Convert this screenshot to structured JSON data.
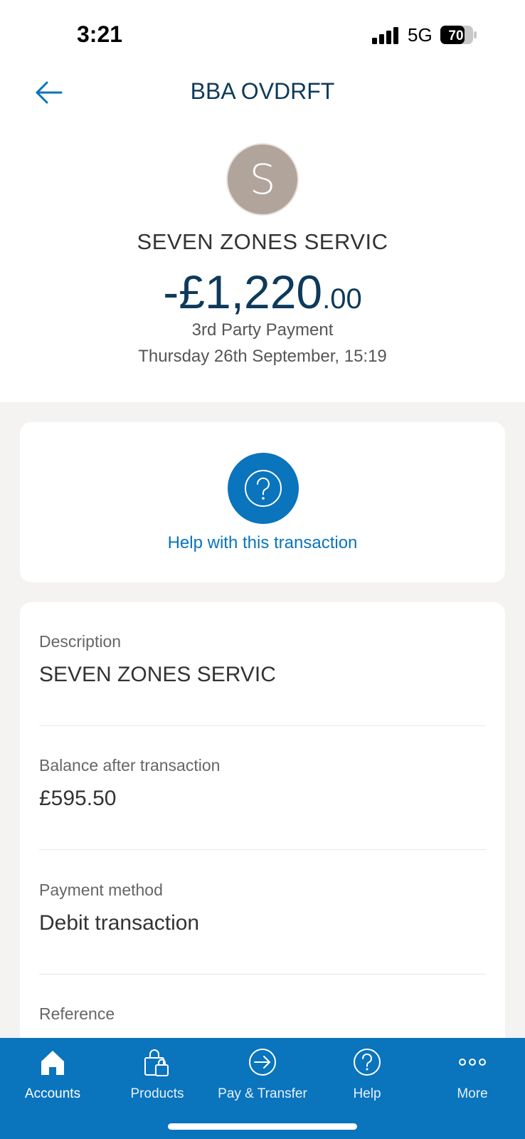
{
  "status_bar": {
    "time": "3:21",
    "network": "5G",
    "battery": "70"
  },
  "header": {
    "title": "BBA OVDRFT"
  },
  "transaction": {
    "avatar_letter": "S",
    "merchant": "SEVEN ZONES SERVIC",
    "amount_main": "-£1,220",
    "amount_decimal": ".00",
    "type": "3rd Party Payment",
    "date": "Thursday 26th September, 15:19"
  },
  "help": {
    "label": "Help with this transaction"
  },
  "details": [
    {
      "label": "Description",
      "value": "SEVEN ZONES SERVIC"
    },
    {
      "label": "Balance after transaction",
      "value": "£595.50"
    },
    {
      "label": "Payment method",
      "value": "Debit transaction"
    },
    {
      "label": "Reference",
      "value": ""
    }
  ],
  "nav": [
    {
      "label": "Accounts",
      "icon": "home-icon",
      "active": true
    },
    {
      "label": "Products",
      "icon": "shopping-bag-icon",
      "active": false
    },
    {
      "label": "Pay & Transfer",
      "icon": "arrow-circle-icon",
      "active": false
    },
    {
      "label": "Help",
      "icon": "question-circle-icon",
      "active": false
    },
    {
      "label": "More",
      "icon": "more-dots-icon",
      "active": false
    }
  ],
  "colors": {
    "brand_blue": "#0a74bd",
    "title_navy": "#0e3a5a",
    "avatar_bg": "#b1a49b",
    "grey_bg": "#f4f3f2"
  }
}
